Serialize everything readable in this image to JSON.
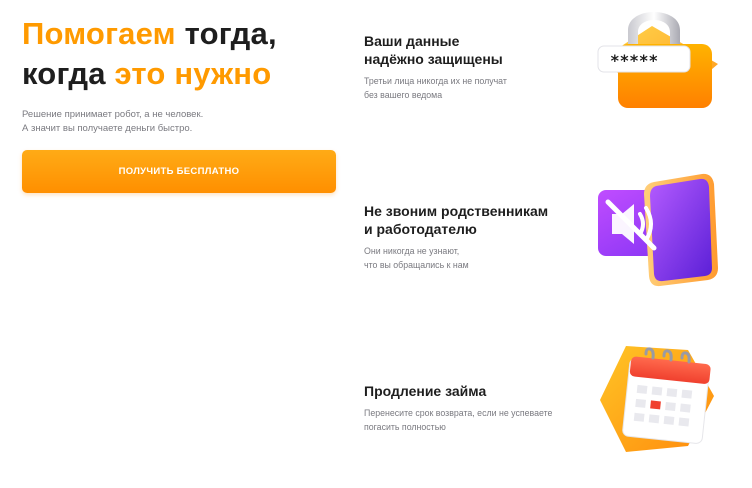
{
  "hero": {
    "title_line1_accent": "Помогаем",
    "title_line1_rest": " тогда,",
    "title_line2_start": "когда ",
    "title_line2_accent": "это нужно",
    "subtitle_line1": "Решение принимает робот, а не человек.",
    "subtitle_line2": "А значит вы получаете деньги быстро.",
    "cta_label": "ПОЛУЧИТЬ БЕСПЛАТНО"
  },
  "features": [
    {
      "title_line1": "Ваши данные",
      "title_line2": "надёжно защищены",
      "desc_line1": "Третьи лица никогда их не получат",
      "desc_line2": "без вашего ведома",
      "icon": "padlock-password-icon",
      "password_mask": "*****"
    },
    {
      "title_line1": "Не звоним родственникам",
      "title_line2": "и работодателю",
      "desc_line1": "Они никогда не узнают,",
      "desc_line2": "что вы обращались к нам",
      "icon": "muted-phone-icon"
    },
    {
      "title_line1": "Продление займа",
      "desc_line1": "Перенесите срок возврата, если не успеваете",
      "desc_line2": "погасить полностью",
      "icon": "calendar-icon"
    }
  ],
  "colors": {
    "accent": "#ff9a00",
    "cta_top": "#ffab16",
    "cta_bottom": "#ff8f00",
    "purple": "#a63ff0",
    "text": "#1e1e1e",
    "muted": "#7a7a80"
  }
}
